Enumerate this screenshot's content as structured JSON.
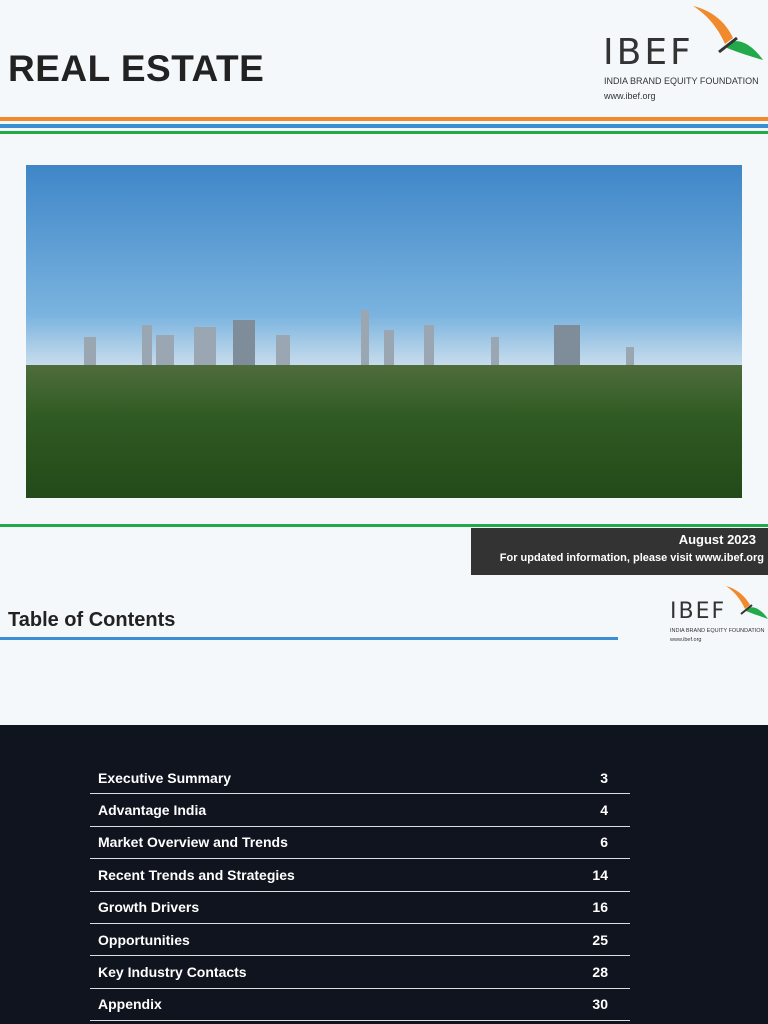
{
  "header": {
    "title": "REAL ESTATE",
    "logo": {
      "name": "IBEF",
      "tagline": "INDIA BRAND EQUITY FOUNDATION",
      "url": "www.ibef.org"
    }
  },
  "colors": {
    "orange": "#f08a2c",
    "blue": "#3a8fd4",
    "green": "#22a94a",
    "dark": "#333333",
    "panel": "#0f141e"
  },
  "cover": {
    "date": "August 2023",
    "note": "For updated information, please visit www.ibef.org"
  },
  "toc": {
    "title": "Table of Contents",
    "items": [
      {
        "label": "Executive Summary",
        "page": "3"
      },
      {
        "label": "Advantage India",
        "page": "4"
      },
      {
        "label": "Market Overview and Trends",
        "page": "6"
      },
      {
        "label": "Recent Trends and Strategies",
        "page": "14"
      },
      {
        "label": "Growth Drivers",
        "page": "16"
      },
      {
        "label": "Opportunities",
        "page": "25"
      },
      {
        "label": "Key Industry Contacts",
        "page": "28"
      },
      {
        "label": "Appendix",
        "page": "30"
      }
    ]
  }
}
